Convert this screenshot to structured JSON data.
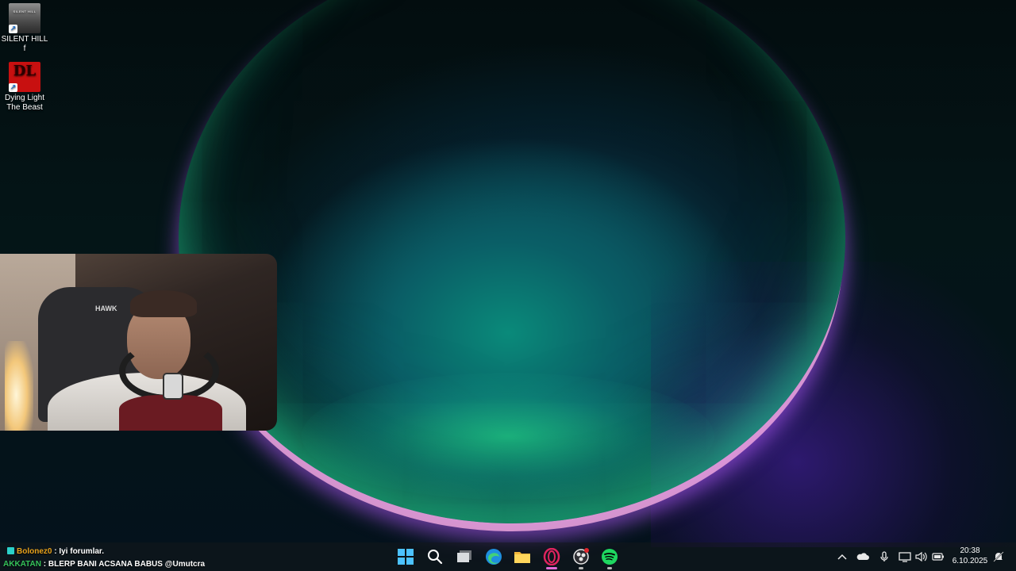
{
  "desktop": {
    "icons": [
      {
        "label": "SILENT HILL f",
        "thumb_text": "SILENT HILL"
      },
      {
        "label_line1": "Dying Light",
        "label_line2": "The Beast",
        "thumb_text": "DL"
      }
    ]
  },
  "chat": {
    "messages": [
      {
        "user": "Bolonez0",
        "text": ": Iyi forumlar."
      },
      {
        "user": "AKKATAN",
        "text": ": BLERP BANI ACSANA BABUS @Umutcra"
      }
    ]
  },
  "webcam": {
    "chair_brand": "HAWK"
  },
  "taskbar": {
    "apps": [
      {
        "name": "start",
        "icon": "windows-logo"
      },
      {
        "name": "search",
        "icon": "search-icon"
      },
      {
        "name": "task-view",
        "icon": "task-view-icon"
      },
      {
        "name": "edge",
        "icon": "edge-icon"
      },
      {
        "name": "file-explorer",
        "icon": "folder-icon"
      },
      {
        "name": "opera-gx",
        "icon": "opera-icon"
      },
      {
        "name": "obs",
        "icon": "obs-icon"
      },
      {
        "name": "spotify",
        "icon": "spotify-icon"
      }
    ],
    "colors": {
      "accent": "#4cc2ff",
      "opera": "#e0245e",
      "spotify": "#1ed760"
    }
  },
  "tray": {
    "time": "20:38",
    "date": "6.10.2025",
    "icons": [
      "chevron-up-icon",
      "onedrive-icon",
      "microphone-icon",
      "network-icon",
      "volume-icon",
      "battery-icon",
      "notification-icon"
    ]
  }
}
